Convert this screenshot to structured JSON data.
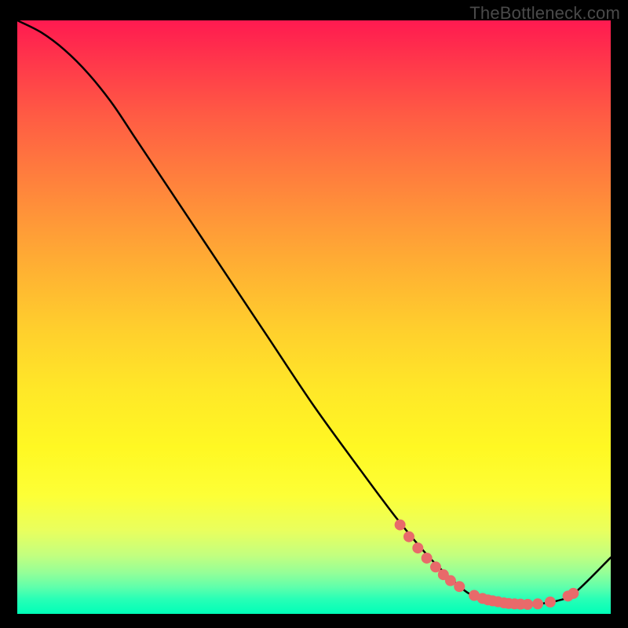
{
  "watermark": "TheBottleneck.com",
  "chart_data": {
    "type": "line",
    "title": "",
    "xlabel": "",
    "ylabel": "",
    "xlim": [
      0,
      100
    ],
    "ylim": [
      0,
      100
    ],
    "series": [
      {
        "name": "curve",
        "x": [
          0,
          4,
          8,
          12,
          16,
          20,
          26,
          34,
          42,
          50,
          58,
          64,
          69,
          73,
          76,
          79,
          82,
          85,
          88,
          91,
          94,
          100
        ],
        "y": [
          100,
          98,
          95,
          91,
          86,
          80,
          71,
          59,
          47,
          35,
          24,
          16,
          10,
          6,
          3.5,
          2.3,
          1.8,
          1.6,
          1.7,
          2.2,
          3.6,
          9.5
        ]
      }
    ],
    "markers": [
      {
        "x": 64.5,
        "y": 15.0
      },
      {
        "x": 66.0,
        "y": 13.0
      },
      {
        "x": 67.5,
        "y": 11.1
      },
      {
        "x": 69.0,
        "y": 9.4
      },
      {
        "x": 70.5,
        "y": 7.9
      },
      {
        "x": 71.8,
        "y": 6.6
      },
      {
        "x": 73.0,
        "y": 5.6
      },
      {
        "x": 74.5,
        "y": 4.6
      },
      {
        "x": 77.0,
        "y": 3.1
      },
      {
        "x": 78.4,
        "y": 2.6
      },
      {
        "x": 79.3,
        "y": 2.35
      },
      {
        "x": 80.1,
        "y": 2.2
      },
      {
        "x": 81.0,
        "y": 2.05
      },
      {
        "x": 82.0,
        "y": 1.85
      },
      {
        "x": 82.8,
        "y": 1.75
      },
      {
        "x": 83.8,
        "y": 1.68
      },
      {
        "x": 84.8,
        "y": 1.63
      },
      {
        "x": 86.0,
        "y": 1.6
      },
      {
        "x": 87.7,
        "y": 1.68
      },
      {
        "x": 89.8,
        "y": 2.0
      },
      {
        "x": 92.8,
        "y": 3.0
      },
      {
        "x": 93.7,
        "y": 3.45
      }
    ],
    "marker_color": "#e86a6a",
    "curve_color": "#000000"
  }
}
